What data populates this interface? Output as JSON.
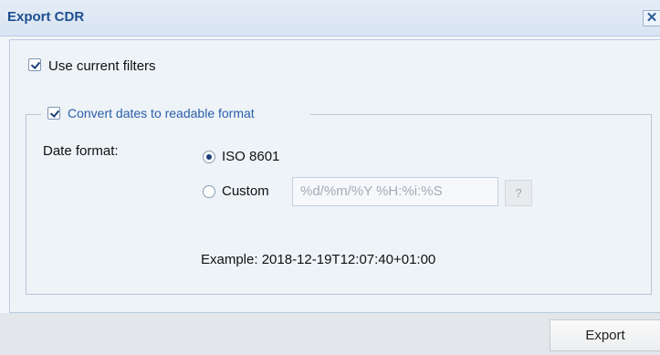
{
  "dialog": {
    "title": "Export CDR",
    "close_glyph": "✕",
    "close_icon": "close-icon"
  },
  "options": {
    "use_current_filters": {
      "label": "Use current filters",
      "checked": true
    },
    "convert_dates": {
      "label": "Convert dates to readable format",
      "checked": true
    }
  },
  "date_format": {
    "label": "Date format:",
    "iso": {
      "label": "ISO 8601",
      "selected": true
    },
    "custom": {
      "label": "Custom",
      "selected": false,
      "placeholder": "%d/%m/%Y %H:%i:%S"
    },
    "help_label": "?",
    "example": "Example: 2018-12-19T12:07:40+01:00"
  },
  "footer": {
    "export_label": "Export"
  },
  "colors": {
    "title": "#1d4f8f",
    "legend": "#2a5ea8",
    "panel_bg": "#eef3f8"
  }
}
